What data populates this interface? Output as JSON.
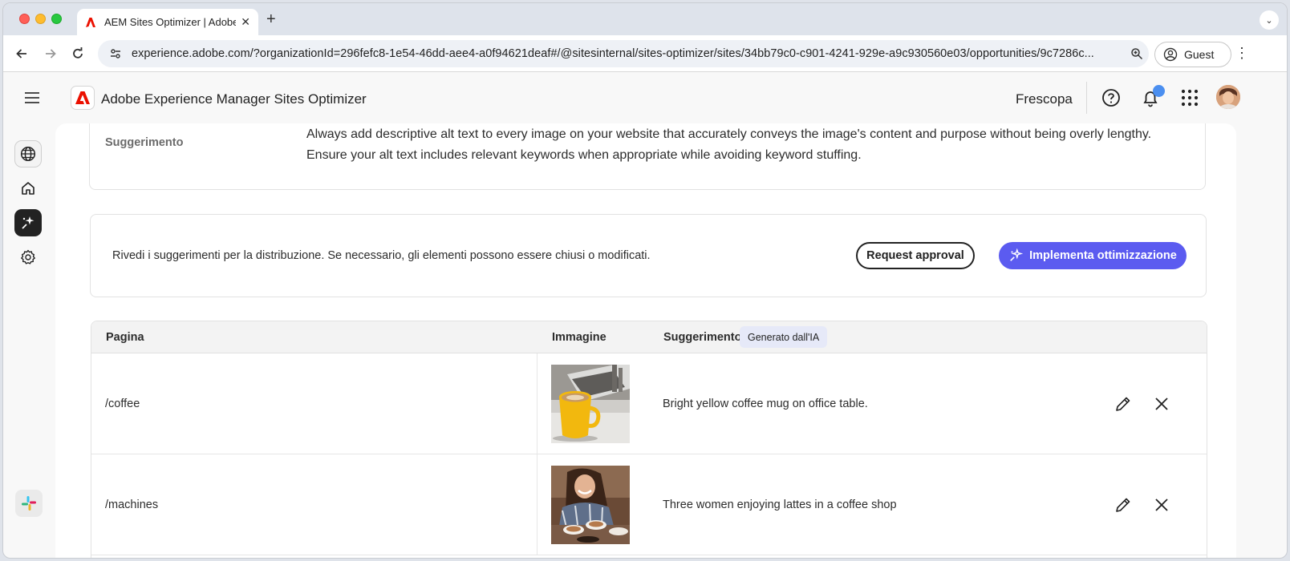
{
  "browser": {
    "tab_title": "AEM Sites Optimizer | Adobe",
    "url": "experience.adobe.com/?organizationId=296fefc8-1e54-46dd-aee4-a0f94621deaf#/@sitesinternal/sites-optimizer/sites/34bb79c0-c901-4241-929e-a9c930560e03/opportunities/9c7286c...",
    "profile_label": "Guest"
  },
  "header": {
    "app_title": "Adobe Experience Manager Sites Optimizer",
    "org_name": "Frescopa"
  },
  "suggestion_card": {
    "label": "Suggerimento",
    "text": "Always add descriptive alt text to every image on your website that accurately conveys the image's content and purpose without being overly lengthy. Ensure your alt text includes relevant keywords when appropriate while avoiding keyword stuffing."
  },
  "actions_card": {
    "message": "Rivedi i suggerimenti per la distribuzione. Se necessario, gli elementi possono essere chiusi o modificati.",
    "request_approval_label": "Request approval",
    "implement_label": "Implementa ottimizzazione"
  },
  "table": {
    "headers": {
      "page": "Pagina",
      "image": "Immagine",
      "suggestion": "Suggerimento",
      "ai_badge": "Generato dall'IA"
    },
    "rows": [
      {
        "page": "/coffee",
        "image_icon": "coffee-mug-photo",
        "suggestion": "Bright yellow coffee mug on office table."
      },
      {
        "page": "/machines",
        "image_icon": "women-lattes-photo",
        "suggestion": "Three women enjoying lattes in a coffee shop"
      }
    ]
  },
  "colors": {
    "accent": "#5b5bf0",
    "adobe_red": "#eb1000",
    "notification": "#4b8ff0"
  }
}
